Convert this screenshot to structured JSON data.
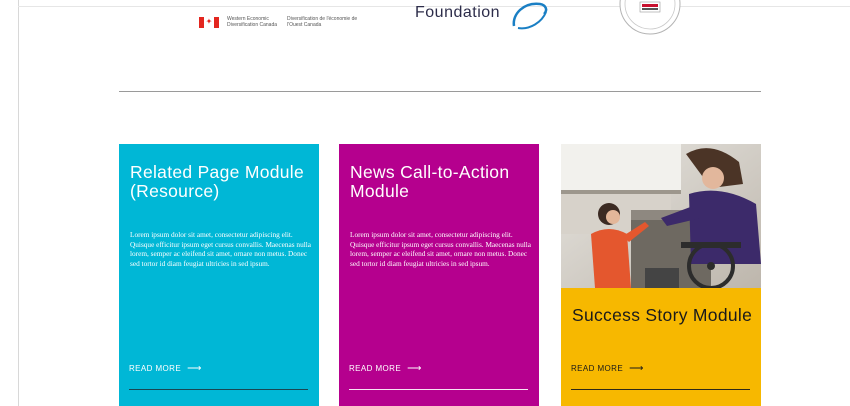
{
  "logos": {
    "gov_en": "Western Economic Diversification Canada",
    "gov_fr": "Diversification de l'économie de l'Ouest Canada",
    "foundation_text": "Foundation",
    "seal_name": "seal-logo"
  },
  "cards": [
    {
      "title": "Related Page Module (Resource)",
      "body": "Lorem ipsum dolor sit amet, consectetur adipiscing elit. Quisque efficitur ipsum eget cursus convallis. Maecenas nulla lorem, semper ac eleifend sit amet, ornare non metus. Donec sed tortor id diam feugiat ultricies in sed ipsum.",
      "read_more": "READ MORE",
      "color": "#00b7d6"
    },
    {
      "title": "News Call-to-Action Module",
      "body": "Lorem ipsum dolor sit amet, consectetur adipiscing elit. Quisque efficitur ipsum eget cursus convallis. Maecenas nulla lorem, semper ac eleifend sit amet, ornare non metus. Donec sed tortor id diam feugiat ultricies in sed ipsum.",
      "read_more": "READ MORE",
      "color": "#b5008e"
    },
    {
      "title": "Success Story Module",
      "read_more": "READ MORE",
      "color": "#f7b800",
      "image": "photo-woman-wheelchair-child"
    }
  ],
  "icons": {
    "arrow": "arrow-right-icon"
  }
}
